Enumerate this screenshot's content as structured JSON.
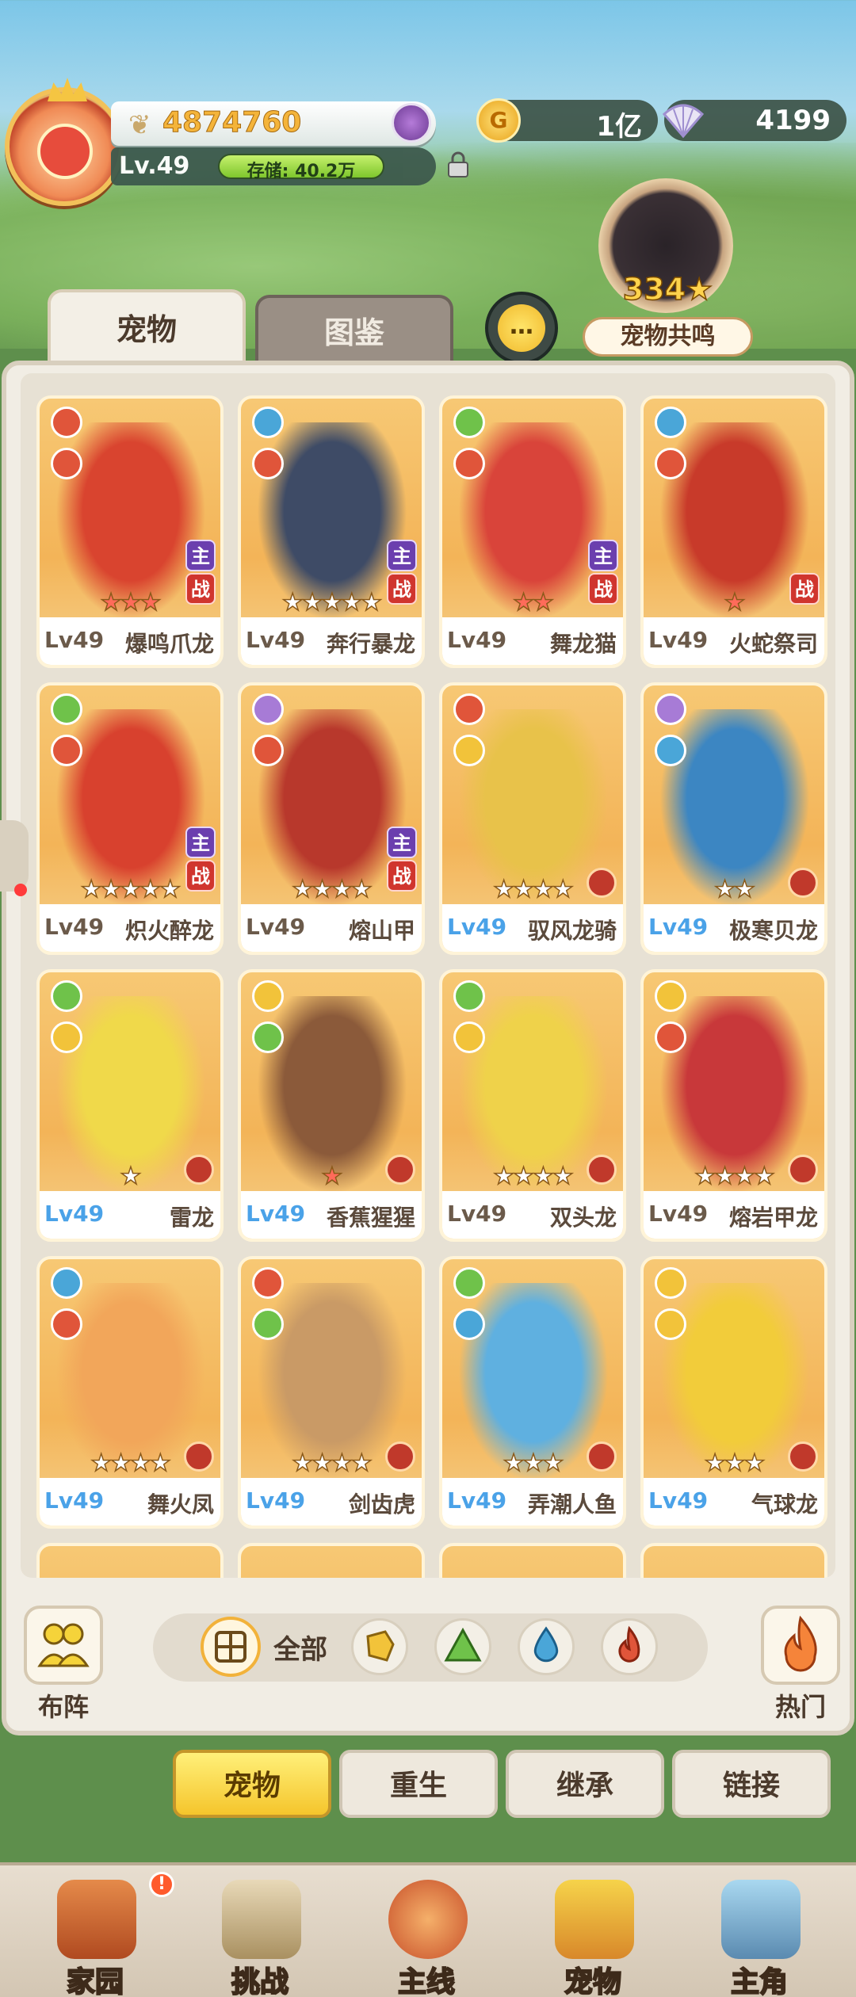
{
  "header": {
    "power": "4874760",
    "level": "Lv.49",
    "storage": "存储: 40.2万",
    "gold": "1亿",
    "shells": "4199",
    "resonance_count": "334",
    "resonance_label": "宠物共鸣"
  },
  "tabs": {
    "active": "宠物",
    "inactive": "图鉴"
  },
  "pets": [
    {
      "lv": "Lv49",
      "name": "爆鸣爪龙",
      "stars": "★★★",
      "lv_color": "gray",
      "el1": "#e0553a",
      "el2": "#e0553a",
      "roles": [
        "主",
        "战"
      ],
      "star_color": "red",
      "art": "#d9442f"
    },
    {
      "lv": "Lv49",
      "name": "奔行暴龙",
      "stars": "★★★★★",
      "lv_color": "gray",
      "el1": "#4aa6d8",
      "el2": "#e0553a",
      "roles": [
        "主",
        "战"
      ],
      "star_color": "white",
      "art": "#3e4b66"
    },
    {
      "lv": "Lv49",
      "name": "舞龙猫",
      "stars": "★★",
      "lv_color": "gray",
      "el1": "#6fc24a",
      "el2": "#e0553a",
      "roles": [
        "主",
        "战"
      ],
      "star_color": "red",
      "art": "#d9443a"
    },
    {
      "lv": "Lv49",
      "name": "火蛇祭司",
      "stars": "★",
      "lv_color": "gray",
      "el1": "#4aa6d8",
      "el2": "#e0553a",
      "roles": [
        "战"
      ],
      "star_color": "red",
      "art": "#c83a2a"
    },
    {
      "lv": "Lv49",
      "name": "炽火醉龙",
      "stars": "★★★★★",
      "lv_color": "gray",
      "el1": "#6fc24a",
      "el2": "#e0553a",
      "roles": [
        "主",
        "战"
      ],
      "star_color": "white",
      "art": "#d8412e"
    },
    {
      "lv": "Lv49",
      "name": "熔山甲",
      "stars": "★★★★",
      "lv_color": "gray",
      "el1": "#a77bd6",
      "el2": "#e0553a",
      "roles": [
        "主",
        "战"
      ],
      "star_color": "white",
      "art": "#b8382c"
    },
    {
      "lv": "Lv49",
      "name": "驭风龙骑",
      "stars": "★★★★",
      "lv_color": "blue",
      "el1": "#e0553a",
      "el2": "#f2c33a",
      "roles": [],
      "star_color": "white",
      "art": "#e8c24a"
    },
    {
      "lv": "Lv49",
      "name": "极寒贝龙",
      "stars": "★★",
      "lv_color": "blue",
      "el1": "#a77bd6",
      "el2": "#4aa6d8",
      "roles": [],
      "star_color": "white",
      "art": "#3c86c2"
    },
    {
      "lv": "Lv49",
      "name": "雷龙",
      "stars": "★",
      "lv_color": "blue",
      "el1": "#6fc24a",
      "el2": "#f2c33a",
      "roles": [],
      "star_color": "white",
      "art": "#f0d94a"
    },
    {
      "lv": "Lv49",
      "name": "香蕉猩猩",
      "stars": "★",
      "lv_color": "blue",
      "el1": "#f2c33a",
      "el2": "#6fc24a",
      "roles": [],
      "star_color": "red",
      "art": "#8b5a3a"
    },
    {
      "lv": "Lv49",
      "name": "双头龙",
      "stars": "★★★★",
      "lv_color": "gray",
      "el1": "#6fc24a",
      "el2": "#f2c33a",
      "roles": [],
      "star_color": "white",
      "art": "#efd24a"
    },
    {
      "lv": "Lv49",
      "name": "熔岩甲龙",
      "stars": "★★★★",
      "lv_color": "gray",
      "el1": "#f2c33a",
      "el2": "#e0553a",
      "roles": [],
      "star_color": "white",
      "art": "#c8383a"
    },
    {
      "lv": "Lv49",
      "name": "舞火凤",
      "stars": "★★★★",
      "lv_color": "blue",
      "el1": "#4aa6d8",
      "el2": "#e0553a",
      "roles": [],
      "star_color": "white",
      "art": "#f2a65a"
    },
    {
      "lv": "Lv49",
      "name": "剑齿虎",
      "stars": "★★★★",
      "lv_color": "blue",
      "el1": "#e0553a",
      "el2": "#6fc24a",
      "roles": [],
      "star_color": "white",
      "art": "#c99a66"
    },
    {
      "lv": "Lv49",
      "name": "弄潮人鱼",
      "stars": "★★★",
      "lv_color": "blue",
      "el1": "#6fc24a",
      "el2": "#4aa6d8",
      "roles": [],
      "star_color": "white",
      "art": "#5fb0e0"
    },
    {
      "lv": "Lv49",
      "name": "气球龙",
      "stars": "★★★",
      "lv_color": "blue",
      "el1": "#f2c33a",
      "el2": "#f2c33a",
      "roles": [],
      "star_color": "white",
      "art": "#f2cc3a"
    }
  ],
  "filters": {
    "formation": "布阵",
    "all": "全部",
    "hot": "热门",
    "elements": [
      "#f2c33a",
      "#6fc24a",
      "#4aa6d8",
      "#e0553a"
    ]
  },
  "subtabs": [
    "宠物",
    "重生",
    "继承",
    "链接"
  ],
  "bottom_nav": [
    {
      "label": "家园",
      "notify": "!"
    },
    {
      "label": "挑战"
    },
    {
      "label": "主线"
    },
    {
      "label": "宠物"
    },
    {
      "label": "主角"
    }
  ]
}
